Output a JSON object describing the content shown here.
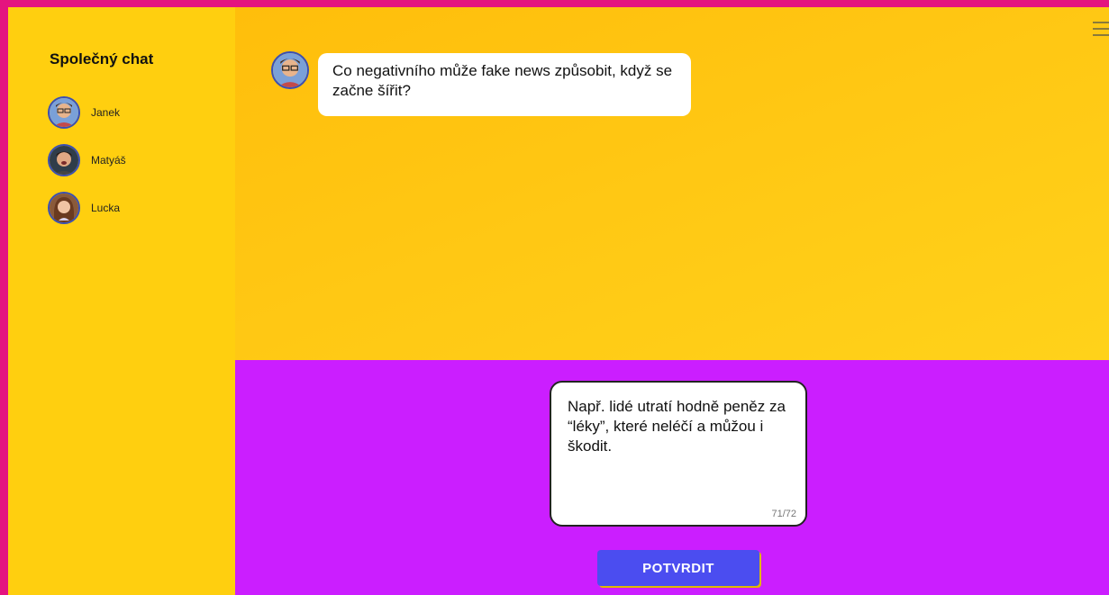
{
  "sidebar": {
    "title": "Společný chat",
    "participants": [
      {
        "name": "Janek",
        "icon": "janek-avatar"
      },
      {
        "name": "Matyáš",
        "icon": "matyas-avatar"
      },
      {
        "name": "Lucka",
        "icon": "lucka-avatar"
      }
    ]
  },
  "chat": {
    "question": "Co negativního může fake news způsobit, když se začne šířit?",
    "question_avatar_icon": "janek-avatar"
  },
  "answer": {
    "text": "Např. lidé utratí hodně peněz za “léky”, které neléčí a můžou i škodit.",
    "counter": "71/72"
  },
  "confirm_button": {
    "label": "POTVRDIT"
  },
  "colors": {
    "frame": "#e4147f",
    "sidebar": "#ffcf0f",
    "chat_background": "#ffc814",
    "answer_background": "#cb1eff",
    "button": "#4b4df0"
  },
  "menu_icon": "hamburger-menu-icon"
}
